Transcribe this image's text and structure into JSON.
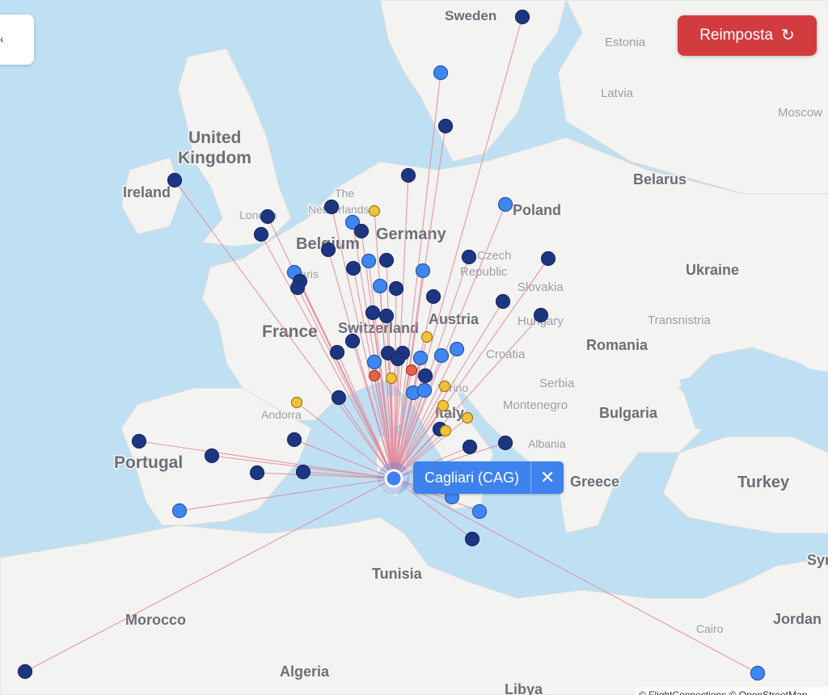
{
  "map": {
    "countries": [
      "Sweden",
      "Estonia",
      "Latvia",
      "Moscow",
      "United",
      "Kingdom",
      "Ireland",
      "The",
      "Netherlands",
      "London",
      "Belgium",
      "Germany",
      "Belarus",
      "Poland",
      "Czech",
      "Republic",
      "Ukraine",
      "Slovakia",
      "Paris",
      "France",
      "Switzerland",
      "Austria",
      "Hungary",
      "Transnistria",
      "Romania",
      "Croatia",
      "Serbia",
      "Torino",
      "Montenegro",
      "Bulgaria",
      "Italy",
      "Andorra",
      "Albania",
      "Portugal",
      "Greece",
      "Turkey",
      "Tunisia",
      "Morocco",
      "Cairo",
      "Jordan",
      "Syr",
      "Algeria",
      "Libya"
    ]
  },
  "toolbar": {
    "reset_label": "Reimposta",
    "reset_icon": "↻"
  },
  "side_panel": {
    "icon": "‹"
  },
  "selected_airport": {
    "label": "Cagliari (CAG)",
    "close_icon": "✕"
  },
  "attribution": "© FlightConnections © OpenStreetMap",
  "colors": {
    "dark_dot": "#1c3682",
    "light_dot": "#3f86f0",
    "yellow_dot": "#f3c23a",
    "red_dot": "#e8634b",
    "route": "#e0889a",
    "accent": "#d23c3f"
  }
}
